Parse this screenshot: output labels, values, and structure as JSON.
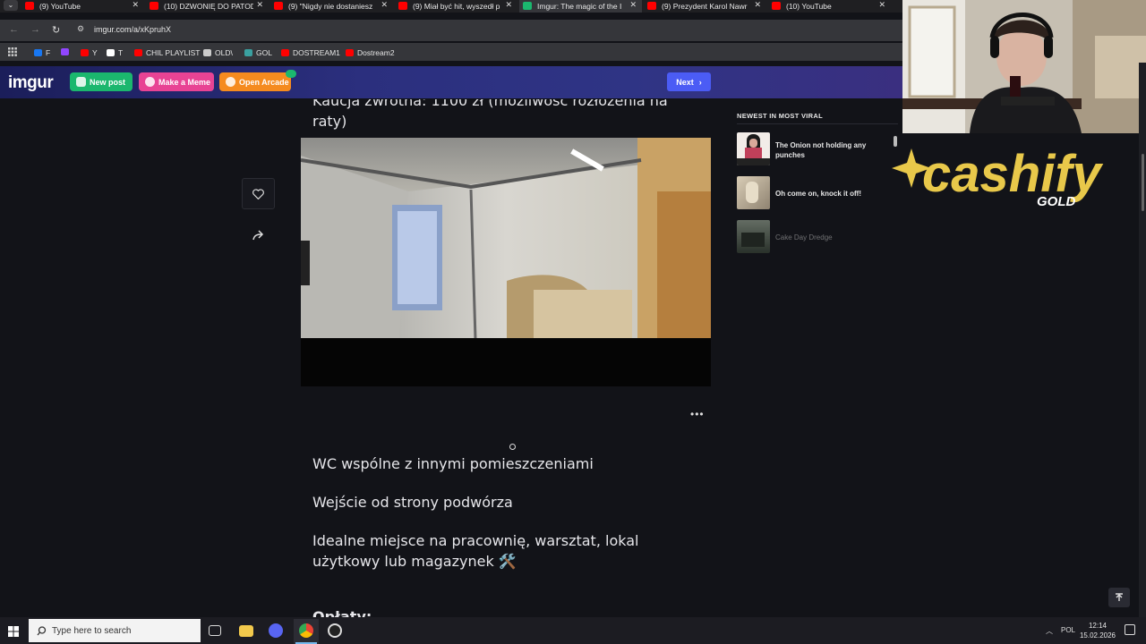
{
  "browser": {
    "tabs": [
      {
        "label": "(9) YouTube",
        "color": "#ff0000"
      },
      {
        "label": "(10) DZWONIĘ DO PATOD",
        "color": "#ff0000"
      },
      {
        "label": "(9) \"Nigdy nie dostaniesz",
        "color": "#ff0000"
      },
      {
        "label": "(9) Miał być hit, wyszedł p",
        "color": "#ff0000"
      },
      {
        "label": "Imgur: The magic of the I",
        "color": "#1bb76e"
      },
      {
        "label": "(9) Prezydent Karol Nawr",
        "color": "#ff0000"
      },
      {
        "label": "(10) YouTube",
        "color": "#ff0000"
      }
    ],
    "url": "imgur.com/a/xKpruhX",
    "bookmarks": [
      {
        "label": "F",
        "icon": "facebook-icon",
        "color": "#1877f2"
      },
      {
        "label": "",
        "icon": "twitch-icon",
        "color": "#9146ff"
      },
      {
        "label": "Y",
        "icon": "youtube-icon",
        "color": "#ff0000"
      },
      {
        "label": "T",
        "icon": "x-icon",
        "color": "#ffffff"
      },
      {
        "label": "CHIL PLAYLIST",
        "icon": "youtube-icon",
        "color": "#ff0000"
      },
      {
        "label": "OLD\\",
        "icon": "folder-icon",
        "color": "#cccccc"
      },
      {
        "label": "GOL",
        "icon": "gol-icon",
        "color": "#3aa0a0"
      },
      {
        "label": "DOSTREAM1",
        "icon": "youtube-icon",
        "color": "#ff0000"
      },
      {
        "label": "Dostream2",
        "icon": "youtube-icon",
        "color": "#ff0000"
      }
    ]
  },
  "imgur": {
    "logo": "imgur",
    "new_post": "New post",
    "make_meme": "Make a Meme",
    "open_arcade": "Open Arcade",
    "next": "Next"
  },
  "post": {
    "top_text": "Kaucja zwrotna: 1100 zł (możliwość rozłożenia na raty)",
    "paragraphs": [
      "WC wspólne z innymi pomieszczeniami",
      "Wejście od strony podwórza",
      "Idealne miejsce na pracownię, warsztat, lokal użytkowy lub magazynek 🛠️"
    ],
    "bottom_heading": "Opłaty:"
  },
  "sidebar": {
    "title": "NEWEST IN MOST VIRAL",
    "items": [
      {
        "title": "The Onion not holding any punches"
      },
      {
        "title": "Oh come on, knock it off!"
      },
      {
        "title": "Cake Day Dredge"
      }
    ]
  },
  "overlay": {
    "brand": "cashify",
    "sub": "GOLD"
  },
  "taskbar": {
    "search_placeholder": "Type here to search",
    "lang": "POL",
    "time": "12:14",
    "date": "15.02.2026"
  }
}
